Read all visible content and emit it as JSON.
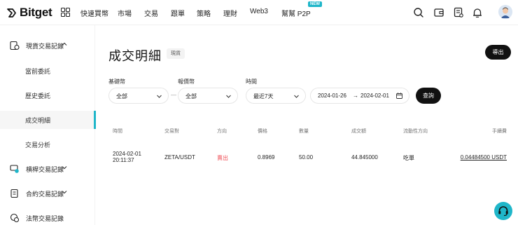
{
  "brand": {
    "name": "Bitget",
    "accent": "#1fb6c9",
    "sell_color": "#f0535a"
  },
  "nav": {
    "items": [
      "快速買幣",
      "市場",
      "交易",
      "跟單",
      "策略",
      "理財",
      "Web3",
      "幫幫 P2P"
    ],
    "new_badge": "NEW",
    "icons": [
      "search-icon",
      "wallet-icon",
      "orders-icon",
      "bell-icon",
      "avatar"
    ]
  },
  "sidebar": {
    "groups": [
      {
        "label": "現貨交易記錄",
        "icon": "spot-record-icon",
        "expanded": true
      },
      {
        "label": "槓桿交易記錄",
        "icon": "margin-record-icon",
        "expanded": false
      },
      {
        "label": "合約交易記錄",
        "icon": "futures-record-icon",
        "expanded": false
      },
      {
        "label": "法幣交易記錄",
        "icon": "fiat-record-icon",
        "expanded": false
      }
    ],
    "subitems": [
      "當前委託",
      "歷史委託",
      "成交明細",
      "交易分析"
    ],
    "active": "成交明細"
  },
  "page": {
    "title": "成交明細",
    "tag": "現貨",
    "export_label": "導出"
  },
  "filters": {
    "base_label": "基礎幣",
    "base_value": "全部",
    "quote_label": "報價幣",
    "quote_value": "全部",
    "range_separator": "—",
    "time_label": "時間",
    "time_value": "最近7天",
    "date_from": "2024-01-26",
    "date_sep": "→",
    "date_to": "2024-02-01",
    "query_label": "查詢"
  },
  "table": {
    "headers": [
      "時間",
      "交易對",
      "方向",
      "價格",
      "數量",
      "成交額",
      "流動性方向",
      "手續費"
    ],
    "rows": [
      {
        "time_date": "2024-02-01",
        "time_clock": "20:11:37",
        "pair": "ZETA/USDT",
        "side": "賣出",
        "price": "0.8969",
        "amount": "50.00",
        "total": "44.845000",
        "liquidity": "吃單",
        "fee": "0.04484500 USDT"
      }
    ]
  }
}
